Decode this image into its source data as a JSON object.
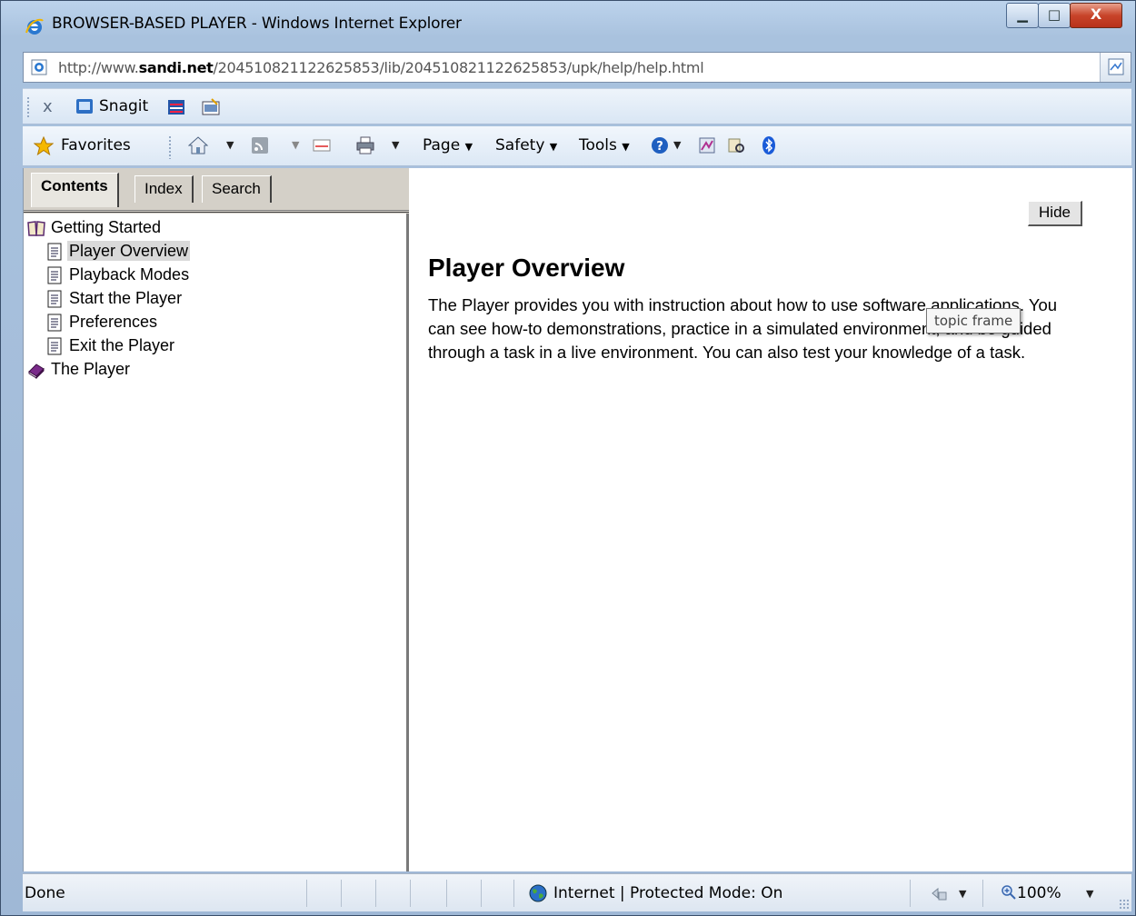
{
  "window": {
    "title": "BROWSER-BASED PLAYER - Windows Internet Explorer",
    "minimize_glyph": "▁",
    "maximize_glyph": "□",
    "close_glyph": "X"
  },
  "address": {
    "prefix": "http://www.",
    "domain": "sandi.net",
    "path": "/204510821122625853/lib/204510821122625853/upk/help/help.html"
  },
  "snagit_toolbar": {
    "close_glyph": "x",
    "label": "Snagit"
  },
  "command_bar": {
    "favorites": "Favorites",
    "page": "Page",
    "safety": "Safety",
    "tools": "Tools",
    "dropdown_glyph": "▼"
  },
  "help": {
    "tabs": [
      {
        "label": "Contents",
        "active": true
      },
      {
        "label": "Index",
        "active": false
      },
      {
        "label": "Search",
        "active": false
      }
    ],
    "tree": [
      {
        "label": "Getting Started",
        "icon": "open-book-icon",
        "level": 0
      },
      {
        "label": "Player Overview",
        "icon": "document-icon",
        "level": 1,
        "selected": true
      },
      {
        "label": "Playback Modes",
        "icon": "document-icon",
        "level": 1
      },
      {
        "label": "Start the Player",
        "icon": "document-icon",
        "level": 1
      },
      {
        "label": "Preferences",
        "icon": "document-icon",
        "level": 1
      },
      {
        "label": "Exit the Player",
        "icon": "document-icon",
        "level": 1
      },
      {
        "label": "The Player",
        "icon": "closed-book-icon",
        "level": 0
      }
    ],
    "hide_button": "Hide",
    "topic_title": "Player Overview",
    "topic_body": "The Player provides you with instruction about how to use software applications. You can see how-to demonstrations, practice in a simulated environment, and be guided through a task in a live environment. You can also test your knowledge of a task.",
    "tooltip": "topic frame"
  },
  "status": {
    "text": "Done",
    "zone": "Internet | Protected Mode: On",
    "zoom": "100%",
    "dropdown_glyph": "▼"
  },
  "colors": {
    "frame": "#a9c2de",
    "close_red": "#c8442a",
    "selected_item": "#d9d9d9"
  }
}
